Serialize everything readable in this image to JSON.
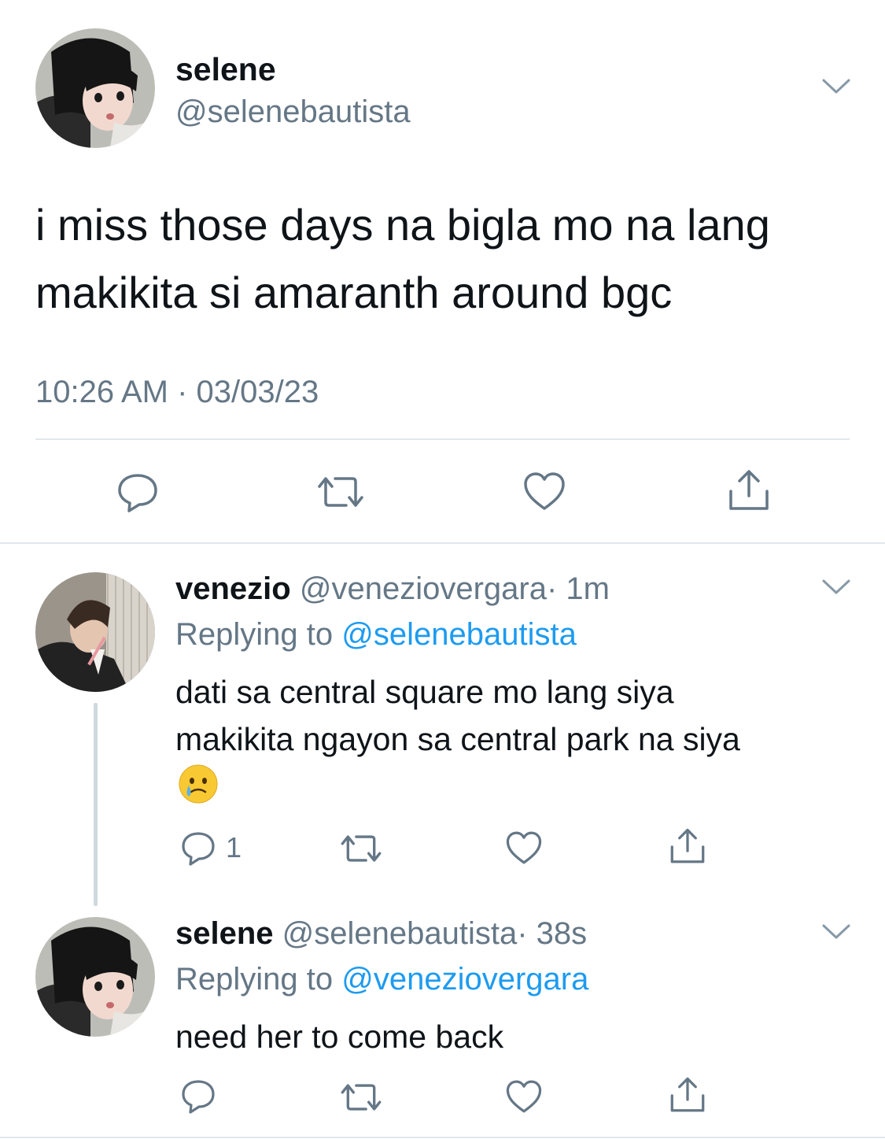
{
  "main_tweet": {
    "display_name": "selene",
    "handle": "@selenebautista",
    "text_line1": "i miss those days na bigla mo na lang",
    "text_line2": "makikita si amaranth around bgc",
    "timestamp": "10:26 AM · 03/03/23"
  },
  "reply1": {
    "display_name": "venezio",
    "handle": "@veneziovergara",
    "time": "· 1m",
    "replying_prefix": "Replying to",
    "replying_handle": "@selenebautista",
    "text_line1": "dati sa central square mo lang siya",
    "text_line2": "makikita ngayon sa central park na siya",
    "emoji": "🥲",
    "reply_count": "1"
  },
  "reply2": {
    "display_name": "selene",
    "handle": "@selenebautista",
    "time": "· 38s",
    "replying_prefix": "Replying to",
    "replying_handle": "@veneziovergara",
    "text": "need her to come back"
  },
  "icons": {
    "reply": "speech-bubble-icon",
    "retweet": "retweet-icon",
    "like": "heart-icon",
    "share": "share-icon",
    "more": "chevron-down-icon"
  },
  "colors": {
    "link": "#1d9bf0",
    "secondary": "#657786",
    "text": "#0f1419"
  }
}
